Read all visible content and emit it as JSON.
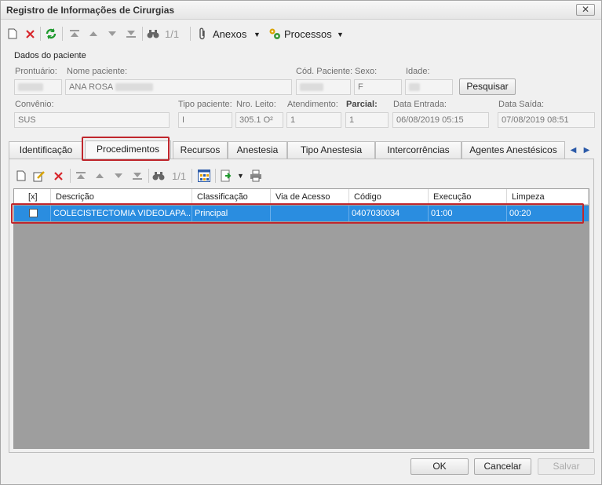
{
  "window": {
    "title": "Registro de Informações de Cirurgias",
    "close_label": "✕"
  },
  "toolbar": {
    "record_position": "1/1",
    "anexos_label": "Anexos",
    "processos_label": "Processos"
  },
  "patient": {
    "group_label": "Dados do paciente",
    "prontuario_label": "Prontuário:",
    "nome_label": "Nome paciente:",
    "nome_value": "ANA ROSA",
    "cod_label": "Cód. Paciente:",
    "sexo_label": "Sexo:",
    "sexo_value": "F",
    "idade_label": "Idade:",
    "pesquisar_label": "Pesquisar",
    "convenio_label": "Convênio:",
    "convenio_value": "SUS",
    "tipo_label": "Tipo paciente:",
    "tipo_value": "I",
    "leito_label": "Nro. Leito:",
    "leito_value": "305.1 O²",
    "atendimento_label": "Atendimento:",
    "atendimento_value": "1",
    "parcial_label": "Parcial:",
    "parcial_value": "1",
    "entrada_label": "Data Entrada:",
    "entrada_value": "06/08/2019 05:15",
    "saida_label": "Data Saída:",
    "saida_value": "07/08/2019 08:51"
  },
  "tabs": [
    {
      "label": "Identificação"
    },
    {
      "label": "Procedimentos"
    },
    {
      "label": "Recursos"
    },
    {
      "label": "Anestesia"
    },
    {
      "label": "Tipo Anestesia"
    },
    {
      "label": "Intercorrências"
    },
    {
      "label": "Agentes Anestésicos"
    }
  ],
  "subtoolbar": {
    "record_position": "1/1"
  },
  "grid": {
    "columns": [
      "[x]",
      "Descrição",
      "Classificação",
      "Via de Acesso",
      "Código",
      "Execução",
      "Limpeza"
    ],
    "rows": [
      {
        "checked": false,
        "descricao": "COLECISTECTOMIA VIDEOLAPA...",
        "classificacao": "Principal",
        "via_acesso": "",
        "codigo": "0407030034",
        "execucao": "01:00",
        "limpeza": "00:20"
      }
    ]
  },
  "footer": {
    "ok_label": "OK",
    "cancelar_label": "Cancelar",
    "salvar_label": "Salvar"
  },
  "colors": {
    "selection": "#2a8de0",
    "highlight_border": "#c0262c",
    "grid_background": "#9e9e9e"
  }
}
